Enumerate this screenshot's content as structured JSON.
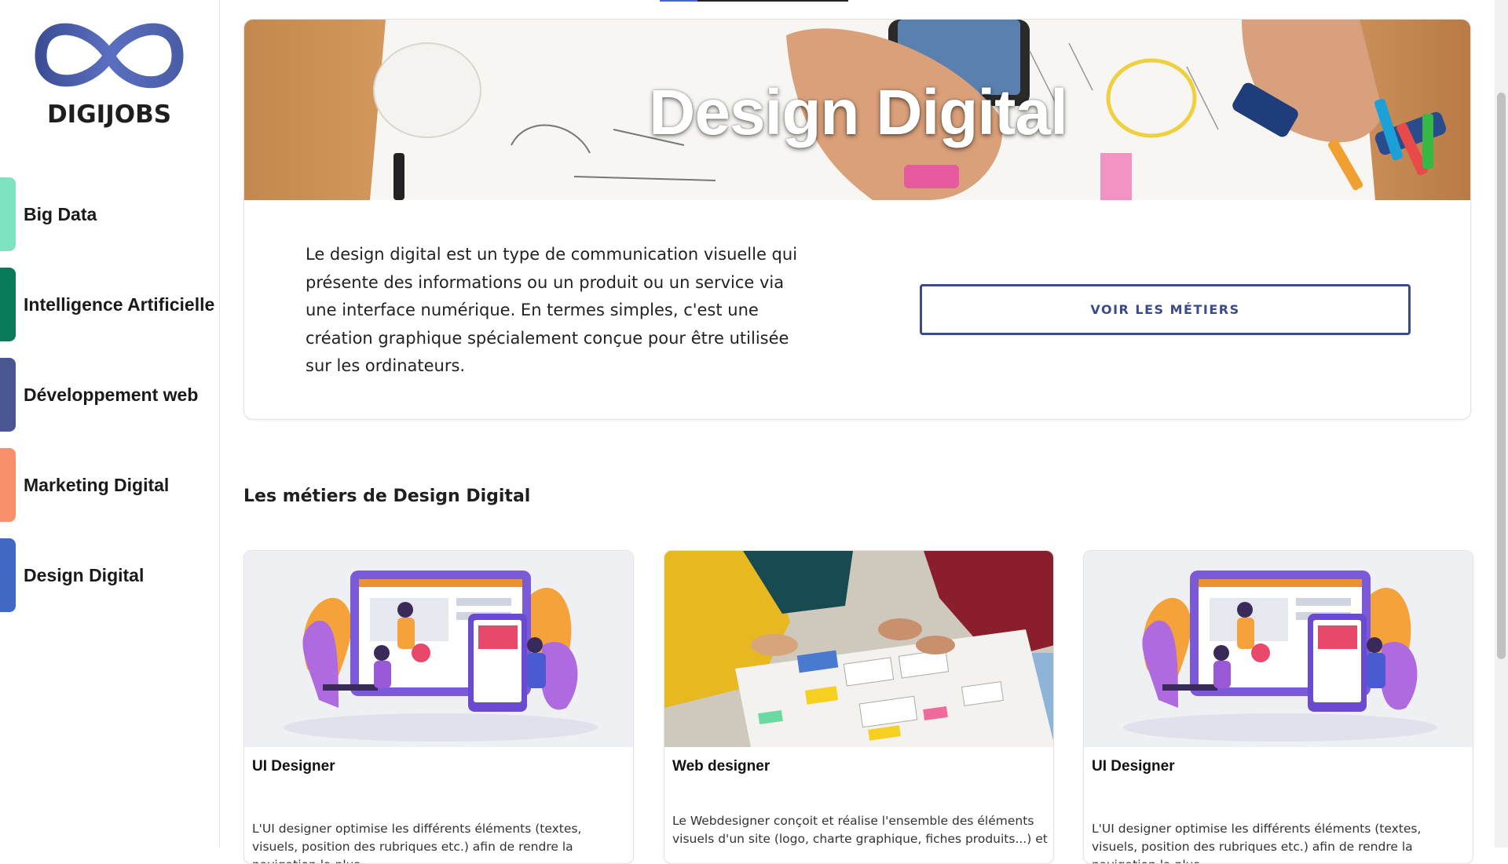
{
  "brand": {
    "name": "DIGIJOBS"
  },
  "sidebar": {
    "items": [
      {
        "label": "Big Data",
        "color": "#7ee3c0"
      },
      {
        "label": "Intelligence Artificielle",
        "color": "#0b7a5a"
      },
      {
        "label": "Développement web",
        "color": "#4a5690"
      },
      {
        "label": "Marketing Digital",
        "color": "#f7906a"
      },
      {
        "label": "Design Digital",
        "color": "#4169c4"
      }
    ]
  },
  "hero": {
    "title": "Design Digital",
    "description": "Le design digital est un type de communication visuelle qui présente des informations ou un produit ou un service via une interface numérique. En termes simples, c'est une création graphique spécialement conçue pour être utilisée sur les ordinateurs.",
    "button_label": "VOIR LES MÉTIERS"
  },
  "jobs_section": {
    "title": "Les métiers de Design Digital",
    "cards": [
      {
        "title": "UI Designer",
        "description": "L'UI designer optimise les différents éléments (textes, visuels, position des rubriques etc.) afin de rendre la navigation la plus"
      },
      {
        "title": "Web designer",
        "description": "Le Webdesigner conçoit et réalise l'ensemble des éléments visuels d'un site (logo, charte graphique, fiches produits...) et"
      },
      {
        "title": "UI Designer",
        "description": "L'UI designer optimise les différents éléments (textes, visuels, position des rubriques etc.) afin de rendre la navigation la plus"
      }
    ]
  }
}
